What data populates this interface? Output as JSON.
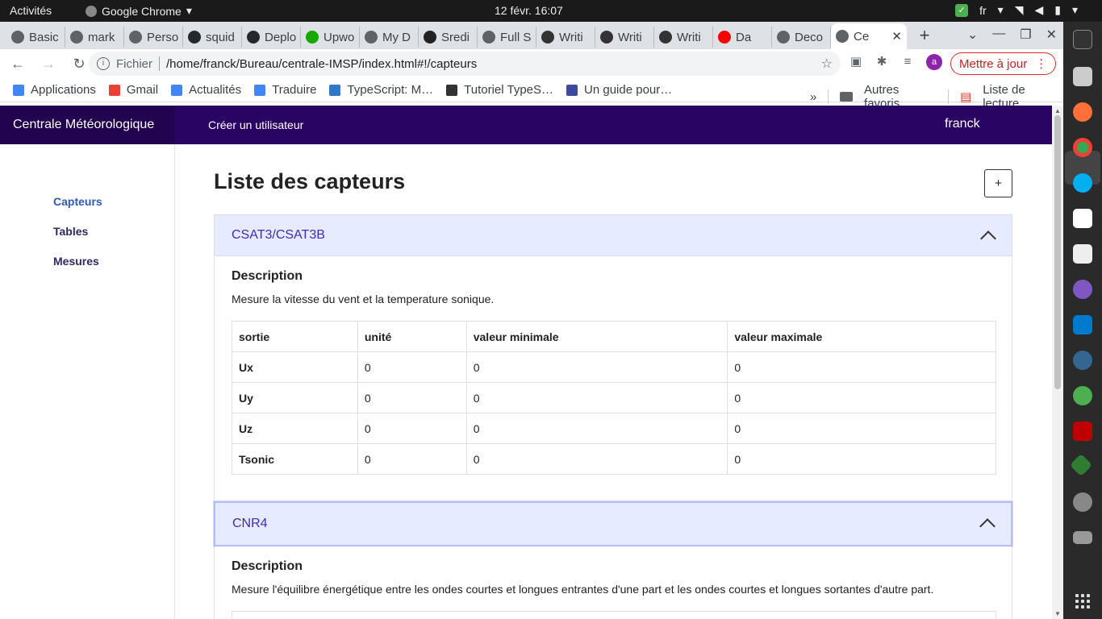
{
  "system": {
    "activities": "Activités",
    "app_name": "Google Chrome",
    "clock": "12 févr.  16:07",
    "lang": "fr"
  },
  "tabs": [
    {
      "label": "Basic",
      "color": "#5f6368"
    },
    {
      "label": "mark",
      "color": "#5f6368"
    },
    {
      "label": "Perso",
      "color": "#5f6368"
    },
    {
      "label": "squid",
      "color": "#24292e"
    },
    {
      "label": "Deplo",
      "color": "#24292e"
    },
    {
      "label": "Upwo",
      "color": "#14a800"
    },
    {
      "label": "My D",
      "color": "#5f6368"
    },
    {
      "label": "Sredi",
      "color": "#222222"
    },
    {
      "label": "Full S",
      "color": "#5f6368"
    },
    {
      "label": "Writi",
      "color": "#333333"
    },
    {
      "label": "Writi",
      "color": "#333333"
    },
    {
      "label": "Writi",
      "color": "#333333"
    },
    {
      "label": "Da",
      "color": "#ff0000"
    },
    {
      "label": "Deco",
      "color": "#5f6368"
    }
  ],
  "active_tab": {
    "label": "Ce"
  },
  "omnibox": {
    "scheme": "Fichier",
    "url": "/home/franck/Bureau/centrale-IMSP/index.html#!/capteurs"
  },
  "update_button": "Mettre à jour",
  "avatar_letter": "a",
  "bookmarks": [
    {
      "label": "Applications",
      "color": "#4285f4"
    },
    {
      "label": "Gmail",
      "color": "#ea4335"
    },
    {
      "label": "Actualités",
      "color": "#4285f4"
    },
    {
      "label": "Traduire",
      "color": "#4285f4"
    },
    {
      "label": "TypeScript: M…",
      "color": "#3178c6"
    },
    {
      "label": "Tutoriel TypeS…",
      "color": "#333333"
    },
    {
      "label": "Un guide pour…",
      "color": "#3d4b9e"
    }
  ],
  "bookmarks_more": "»",
  "other_bookmarks": "Autres favoris",
  "reading_list": "Liste de lecture",
  "app": {
    "brand": "Centrale Météorologique",
    "nav_create_user": "Créer un utilisateur",
    "user": "franck",
    "sidebar": [
      "Capteurs",
      "Tables",
      "Mesures"
    ],
    "page_title": "Liste des capteurs",
    "add_button": "+",
    "sensors": [
      {
        "name": "CSAT3/CSAT3B",
        "desc_title": "Description",
        "description": "Mesure la vitesse du vent et la temperature sonique.",
        "columns": [
          "sortie",
          "unité",
          "valeur minimale",
          "valeur maximale"
        ],
        "rows": [
          [
            "Ux",
            "0",
            "0",
            "0"
          ],
          [
            "Uy",
            "0",
            "0",
            "0"
          ],
          [
            "Uz",
            "0",
            "0",
            "0"
          ],
          [
            "Tsonic",
            "0",
            "0",
            "0"
          ]
        ]
      },
      {
        "name": "CNR4",
        "desc_title": "Description",
        "description": "Mesure l'équilibre énergétique entre les ondes courtes et longues entrantes d'une part et les ondes courtes et longues sortantes d'autre part."
      }
    ]
  }
}
